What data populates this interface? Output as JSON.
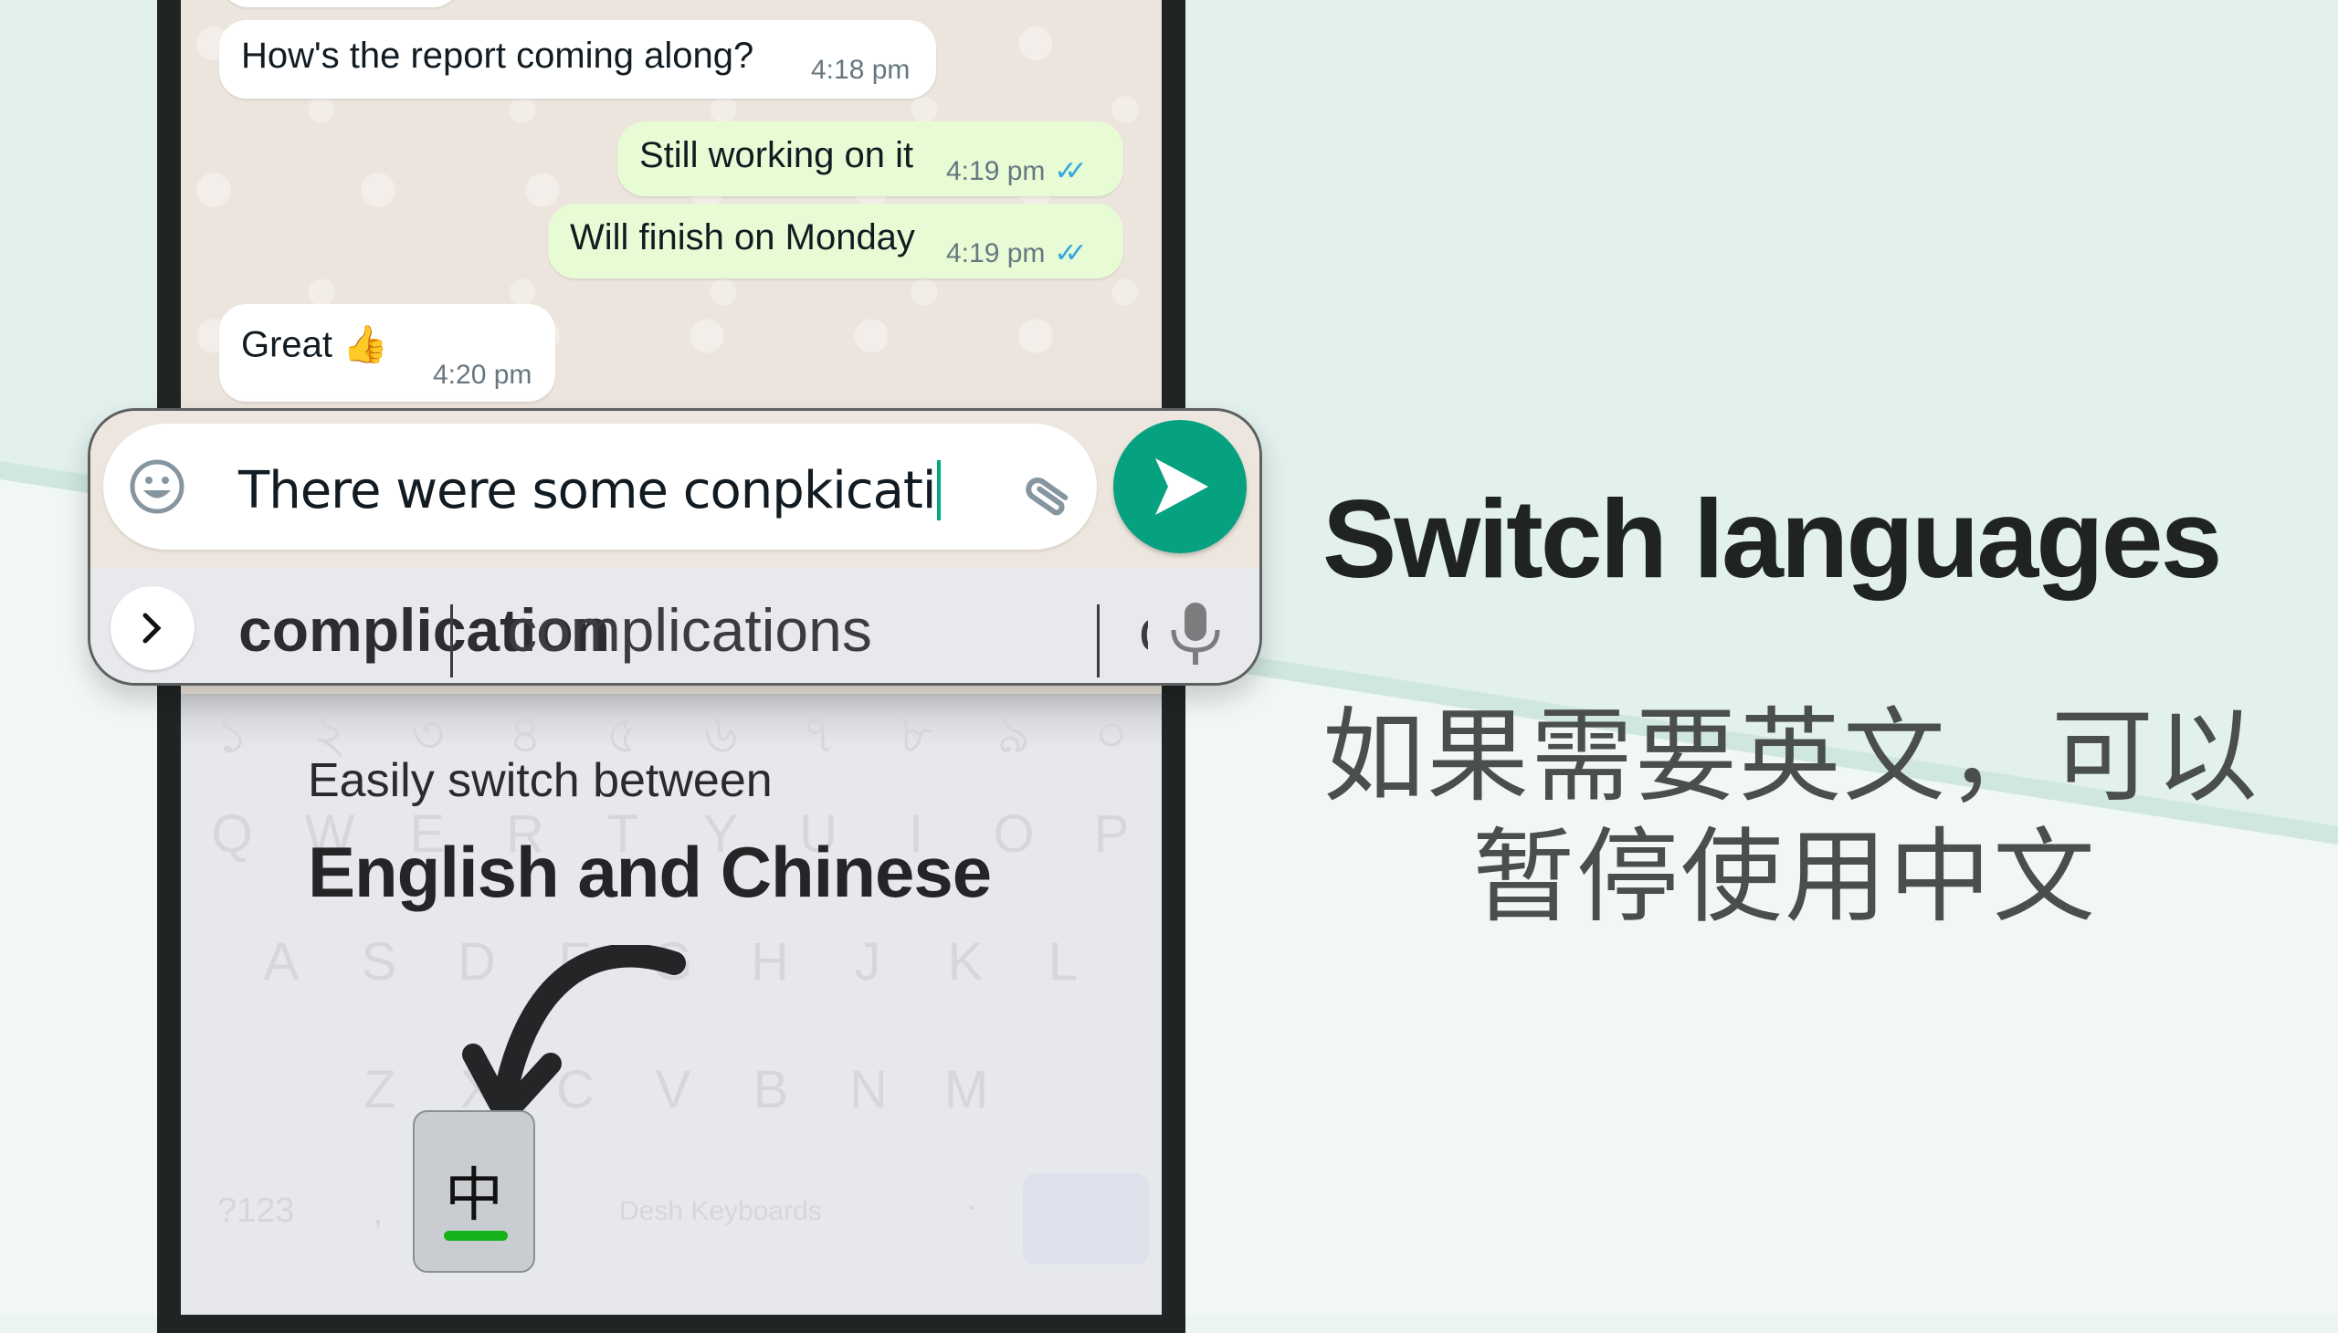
{
  "chat": {
    "messages": [
      {
        "direction": "incoming",
        "text": "How's the report coming along?",
        "time": "4:18 pm"
      },
      {
        "direction": "outgoing",
        "text": "Still working on it",
        "time": "4:19 pm",
        "status": "read"
      },
      {
        "direction": "outgoing",
        "text": "Will finish on Monday",
        "time": "4:19 pm",
        "status": "read"
      },
      {
        "direction": "incoming",
        "text": "Great 👍",
        "time": "4:20 pm"
      }
    ],
    "read_tick_color": "#34a6e0"
  },
  "compose": {
    "input_value": "There were some conpkicati",
    "emoji_icon": "emoji-icon",
    "attach_icon": "paperclip-icon",
    "send_icon": "send-icon",
    "send_color": "#06a17f"
  },
  "suggestions": {
    "expand_icon": "chevron-right-icon",
    "items": [
      "complication",
      "complications",
      "c"
    ],
    "mic_icon": "microphone-icon"
  },
  "keyboard": {
    "number_row": [
      "১",
      "২",
      "৩",
      "৪",
      "৫",
      "৬",
      "৭",
      "৮",
      "৯",
      "০"
    ],
    "row1": [
      "Q",
      "W",
      "E",
      "R",
      "T",
      "Y",
      "U",
      "I",
      "O",
      "P"
    ],
    "row2": [
      "A",
      "S",
      "D",
      "F",
      "G",
      "H",
      "J",
      "K",
      "L"
    ],
    "row3": [
      "Z",
      "X",
      "C",
      "V",
      "B",
      "N",
      "M"
    ],
    "symbols_key": "?123",
    "comma_key": ",",
    "space_label": "Desh Keyboards",
    "period_key": ".",
    "language_key": {
      "label": "中",
      "indicator_color": "#17b21b"
    }
  },
  "promo": {
    "subtitle": "Easily switch between",
    "title": "English and Chinese"
  },
  "hero": {
    "headline": "Switch languages",
    "zh_line1": "如果需要英文，可以",
    "zh_line2": "暂停使用中文"
  }
}
